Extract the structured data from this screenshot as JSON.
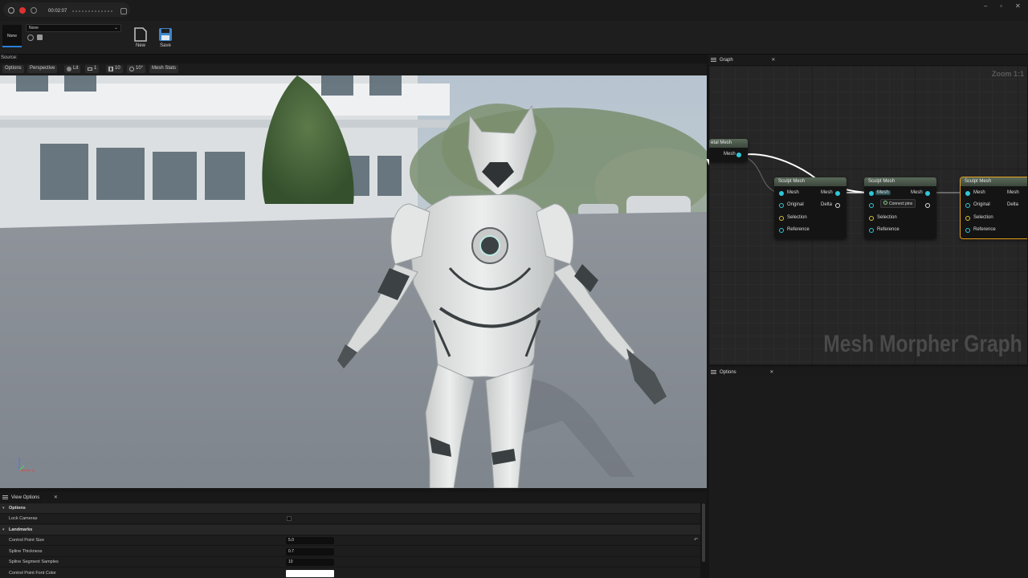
{
  "recorder": {
    "time": "00:02:07"
  },
  "toolbar": {
    "asset_thumb_label": "None",
    "asset_select_value": "None",
    "new_label": "New",
    "save_label": "Save"
  },
  "source_label": "Source:",
  "viewport_toolbar": {
    "options": "Options",
    "perspective": "Perspective",
    "lit": "Lit",
    "camera_speed": "1",
    "grid_size": "10",
    "rotation_snap": "10°",
    "mesh_stats": "Mesh Stats"
  },
  "graph": {
    "tab_label": "Graph",
    "zoom_label": "Zoom 1:1",
    "watermark": "Mesh Morpher Graph",
    "source_node": {
      "title": "etal Mesh",
      "pin": "Mesh"
    },
    "sculpt_nodes": [
      {
        "title": "Sculpt Mesh",
        "in_pins": [
          "Mesh",
          "Original",
          "Selection",
          "Reference"
        ],
        "out_pins": [
          "Mesh",
          "Delta"
        ]
      },
      {
        "title": "Sculpt Mesh",
        "in_pins": [
          "Mesh",
          "Original",
          "Selection",
          "Reference"
        ],
        "out_pins": [
          "Mesh",
          "Delta"
        ]
      },
      {
        "title": "Sculpt Mesh",
        "in_pins": [
          "Mesh",
          "Original",
          "Selection",
          "Reference"
        ],
        "out_pins": [
          "Mesh",
          "Delta"
        ]
      }
    ],
    "tooltip": "Connect pins"
  },
  "options_panel": {
    "tab_label": "Options"
  },
  "view_options": {
    "tab_label": "View Options",
    "rows": [
      {
        "type": "category",
        "label": "Options"
      },
      {
        "type": "checkbox",
        "label": "Lock Cameras"
      },
      {
        "type": "category",
        "label": "Landmarks"
      },
      {
        "type": "number",
        "label": "Control Point Size",
        "value": "5.0"
      },
      {
        "type": "number",
        "label": "Spline Thickness",
        "value": "0.7"
      },
      {
        "type": "number",
        "label": "Spline Segment Samples",
        "value": "10"
      },
      {
        "type": "color",
        "label": "Control Point Font Color",
        "value": "#ffffff"
      }
    ]
  },
  "colors": {
    "accent_blue": "#2b7fd6",
    "pin_cyan": "#2fc6d8",
    "selection_orange": "#e6a01a",
    "node_header": "#4b584b"
  },
  "icons": [
    "record-icon",
    "stop-icon",
    "play-icon",
    "new-asset-icon",
    "save-icon",
    "lit-sphere-icon",
    "camera-icon",
    "grid-icon",
    "rotation-snap-icon",
    "hamburger-icon",
    "close-icon",
    "reset-icon",
    "axis-gizmo-icon"
  ]
}
